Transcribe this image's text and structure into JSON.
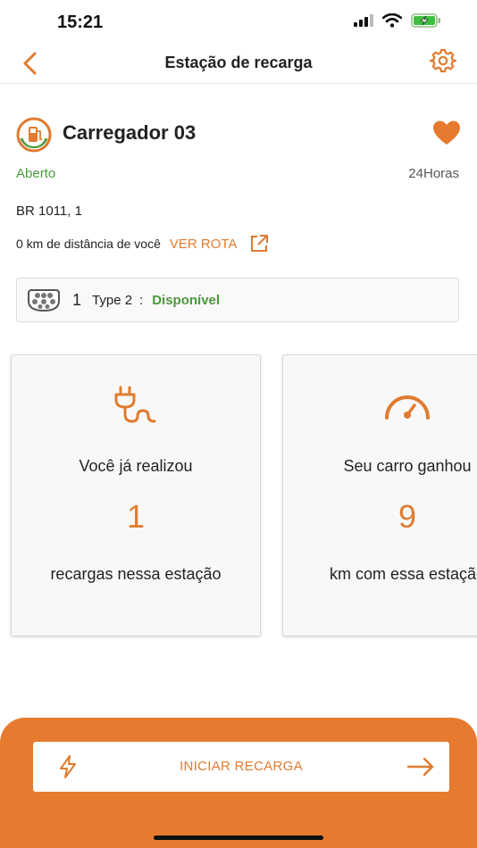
{
  "status_bar": {
    "time": "15:21",
    "icons": [
      "signal-icon",
      "wifi-icon",
      "battery-charging-icon"
    ]
  },
  "nav": {
    "title": "Estação de recarga",
    "back_icon": "chevron-left-icon",
    "settings_icon": "gear-icon"
  },
  "station": {
    "name": "Carregador 03",
    "logo_icon": "charging-station-logo",
    "favorite_icon": "heart-icon",
    "status": "Aberto",
    "hours": "24Horas",
    "address": "BR 1011, 1",
    "distance_text": "0 km de distância de você",
    "route_label": "VER ROTA",
    "route_icon": "external-link-icon"
  },
  "connector": {
    "icon": "type2-connector-icon",
    "count": "1",
    "type": "Type 2",
    "separator": ":",
    "status": "Disponível"
  },
  "stats": [
    {
      "icon": "plug-icon",
      "intro": "Você já realizou",
      "value": "1",
      "description": "recargas nessa estação"
    },
    {
      "icon": "speedometer-icon",
      "intro": "Seu carro ganhou",
      "value": "9",
      "description": "km com essa estação"
    }
  ],
  "start_button": {
    "label": "INICIAR RECARGA",
    "left_icon": "lightning-icon",
    "right_icon": "arrow-right-icon"
  },
  "colors": {
    "accent": "#e67a2e",
    "open_green": "#4a9a3a",
    "card_bg": "#f8f8f8"
  }
}
